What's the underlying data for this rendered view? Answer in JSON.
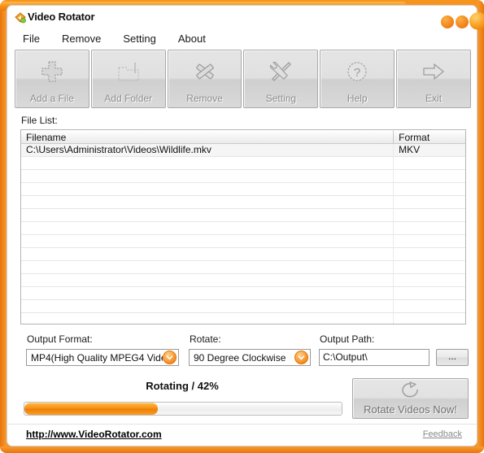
{
  "window": {
    "title": "Video Rotator",
    "app_icon": "app-logo-icon",
    "controls": {
      "minimize": "minimize-button",
      "maximize": "maximize-button",
      "close": "close-button"
    },
    "frame_color": "#f7941d"
  },
  "menu": {
    "items": [
      {
        "label": "File"
      },
      {
        "label": "Remove"
      },
      {
        "label": "Setting"
      },
      {
        "label": "About"
      }
    ]
  },
  "toolbar": {
    "buttons": [
      {
        "label": "Add a File",
        "icon": "add-file-icon"
      },
      {
        "label": "Add Folder",
        "icon": "add-folder-icon"
      },
      {
        "label": "Remove",
        "icon": "remove-x-icon"
      },
      {
        "label": "Setting",
        "icon": "settings-tools-icon"
      },
      {
        "label": "Help",
        "icon": "help-question-icon"
      },
      {
        "label": "Exit",
        "icon": "exit-arrow-icon"
      }
    ]
  },
  "file_list": {
    "section_label": "File List:",
    "columns": [
      {
        "label": "Filename"
      },
      {
        "label": "Format"
      }
    ],
    "rows": [
      {
        "filename": "C:\\Users\\Administrator\\Videos\\Wildlife.mkv",
        "format": "MKV"
      }
    ],
    "empty_row_count": 13
  },
  "options": {
    "output_format": {
      "label": "Output Format:",
      "value": "MP4(High Quality MPEG4 Vide"
    },
    "rotate": {
      "label": "Rotate:",
      "value": "90 Degree Clockwise"
    },
    "output_path": {
      "label": "Output Path:",
      "value": "C:\\Output\\",
      "browse_label": "..."
    }
  },
  "progress": {
    "status_text": "Rotating / 42%",
    "percent": 42,
    "bar_color": "#f79316"
  },
  "action": {
    "rotate_button_label": "Rotate Videos Now!",
    "rotate_button_icon": "rotate-circular-arrow-icon"
  },
  "footer": {
    "site_url": "http://www.VideoRotator.com",
    "feedback_label": "Feedback"
  }
}
